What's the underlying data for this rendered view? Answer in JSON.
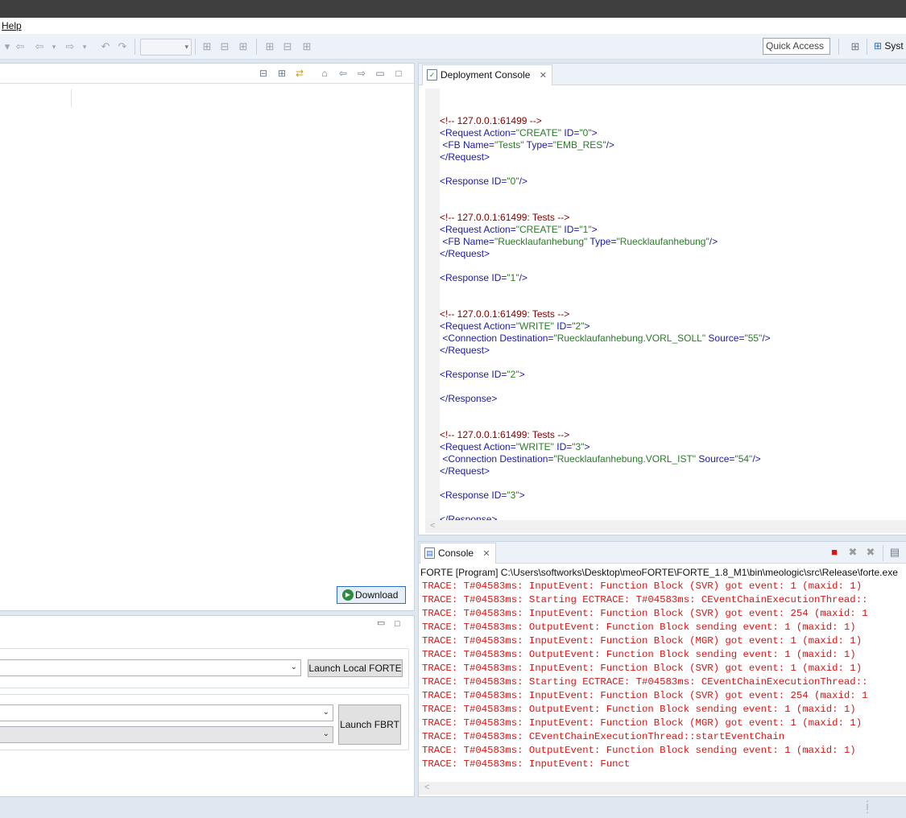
{
  "menubar": {
    "help": "Help"
  },
  "toolbar": {
    "quick_access": "Quick Access",
    "perspective": "Syst",
    "icons": [
      "back-icon",
      "forward-icon",
      "undo-icon",
      "redo-icon",
      "layout-icon"
    ]
  },
  "left_panel": {
    "download_button": "Download",
    "launch_local_forte": "Launch Local FORTE",
    "launch_fbrt": "Launch FBRT"
  },
  "deployment_console": {
    "tab_label": "Deployment Console",
    "lines": [
      {
        "parts": [
          {
            "c": "cm",
            "t": "<!-- 127.0.0.1:61499 -->"
          }
        ]
      },
      {
        "parts": [
          {
            "c": "tg",
            "t": "<Request Action="
          },
          {
            "c": "val",
            "t": "\"CREATE\""
          },
          {
            "c": "tg",
            "t": " ID="
          },
          {
            "c": "val",
            "t": "\"0\""
          },
          {
            "c": "tg",
            "t": ">"
          }
        ]
      },
      {
        "parts": [
          {
            "c": "tg",
            "t": " <FB Name="
          },
          {
            "c": "val",
            "t": "\"Tests\""
          },
          {
            "c": "tg",
            "t": " Type="
          },
          {
            "c": "val",
            "t": "\"EMB_RES\""
          },
          {
            "c": "tg",
            "t": "/>"
          }
        ]
      },
      {
        "parts": [
          {
            "c": "tg",
            "t": "</Request>"
          }
        ]
      },
      {
        "parts": []
      },
      {
        "parts": [
          {
            "c": "tg",
            "t": "<Response ID="
          },
          {
            "c": "val",
            "t": "\"0\""
          },
          {
            "c": "tg",
            "t": "/>"
          }
        ]
      },
      {
        "parts": []
      },
      {
        "parts": []
      },
      {
        "parts": [
          {
            "c": "cm",
            "t": "<!-- 127.0.0.1:61499: Tests -->"
          }
        ]
      },
      {
        "parts": [
          {
            "c": "tg",
            "t": "<Request Action="
          },
          {
            "c": "val",
            "t": "\"CREATE\""
          },
          {
            "c": "tg",
            "t": " ID="
          },
          {
            "c": "val",
            "t": "\"1\""
          },
          {
            "c": "tg",
            "t": ">"
          }
        ]
      },
      {
        "parts": [
          {
            "c": "tg",
            "t": " <FB Name="
          },
          {
            "c": "val",
            "t": "\"Ruecklaufanhebung\""
          },
          {
            "c": "tg",
            "t": " Type="
          },
          {
            "c": "val",
            "t": "\"Ruecklaufanhebung\""
          },
          {
            "c": "tg",
            "t": "/>"
          }
        ]
      },
      {
        "parts": [
          {
            "c": "tg",
            "t": "</Request>"
          }
        ]
      },
      {
        "parts": []
      },
      {
        "parts": [
          {
            "c": "tg",
            "t": "<Response ID="
          },
          {
            "c": "val",
            "t": "\"1\""
          },
          {
            "c": "tg",
            "t": "/>"
          }
        ]
      },
      {
        "parts": []
      },
      {
        "parts": []
      },
      {
        "parts": [
          {
            "c": "cm",
            "t": "<!-- 127.0.0.1:61499: Tests -->"
          }
        ]
      },
      {
        "parts": [
          {
            "c": "tg",
            "t": "<Request Action="
          },
          {
            "c": "val",
            "t": "\"WRITE\""
          },
          {
            "c": "tg",
            "t": " ID="
          },
          {
            "c": "val",
            "t": "\"2\""
          },
          {
            "c": "tg",
            "t": ">"
          }
        ]
      },
      {
        "parts": [
          {
            "c": "tg",
            "t": " <Connection Destination="
          },
          {
            "c": "val",
            "t": "\"Ruecklaufanhebung.VORL_SOLL\""
          },
          {
            "c": "tg",
            "t": " Source="
          },
          {
            "c": "val",
            "t": "\"55\""
          },
          {
            "c": "tg",
            "t": "/>"
          }
        ]
      },
      {
        "parts": [
          {
            "c": "tg",
            "t": "</Request>"
          }
        ]
      },
      {
        "parts": []
      },
      {
        "parts": [
          {
            "c": "tg",
            "t": "<Response ID="
          },
          {
            "c": "val",
            "t": "\"2\""
          },
          {
            "c": "tg",
            "t": ">"
          }
        ]
      },
      {
        "parts": []
      },
      {
        "parts": [
          {
            "c": "tg",
            "t": "</Response>"
          }
        ]
      },
      {
        "parts": []
      },
      {
        "parts": []
      },
      {
        "parts": [
          {
            "c": "cm",
            "t": "<!-- 127.0.0.1:61499: Tests -->"
          }
        ]
      },
      {
        "parts": [
          {
            "c": "tg",
            "t": "<Request Action="
          },
          {
            "c": "val",
            "t": "\"WRITE\""
          },
          {
            "c": "tg",
            "t": " ID="
          },
          {
            "c": "val",
            "t": "\"3\""
          },
          {
            "c": "tg",
            "t": ">"
          }
        ]
      },
      {
        "parts": [
          {
            "c": "tg",
            "t": " <Connection Destination="
          },
          {
            "c": "val",
            "t": "\"Ruecklaufanhebung.VORL_IST\""
          },
          {
            "c": "tg",
            "t": " Source="
          },
          {
            "c": "val",
            "t": "\"54\""
          },
          {
            "c": "tg",
            "t": "/>"
          }
        ]
      },
      {
        "parts": [
          {
            "c": "tg",
            "t": "</Request>"
          }
        ]
      },
      {
        "parts": []
      },
      {
        "parts": [
          {
            "c": "tg",
            "t": "<Response ID="
          },
          {
            "c": "val",
            "t": "\"3\""
          },
          {
            "c": "tg",
            "t": ">"
          }
        ]
      },
      {
        "parts": []
      },
      {
        "parts": [
          {
            "c": "tg",
            "t": "</Response>"
          }
        ]
      }
    ]
  },
  "console": {
    "tab_label": "Console",
    "process_label": "FORTE [Program] C:\\Users\\softworks\\Desktop\\meoFORTE\\FORTE_1.8_M1\\bin\\meologic\\src\\Release\\forte.exe",
    "trace_lines": [
      "TRACE: T#04583ms: InputEvent: Function Block (SVR) got event: 1 (maxid: 1)",
      "TRACE: T#04583ms: Starting ECTRACE: T#04583ms: CEventChainExecutionThread::",
      "TRACE: T#04583ms: InputEvent: Function Block (SVR) got event: 254 (maxid: 1",
      "TRACE: T#04583ms: OutputEvent: Function Block sending event: 1 (maxid: 1)",
      "TRACE: T#04583ms: InputEvent: Function Block (MGR) got event: 1 (maxid: 1)",
      "TRACE: T#04583ms: OutputEvent: Function Block sending event: 1 (maxid: 1)",
      "TRACE: T#04583ms: InputEvent: Function Block (SVR) got event: 1 (maxid: 1)",
      "TRACE: T#04583ms: Starting ECTRACE: T#04583ms: CEventChainExecutionThread::",
      "TRACE: T#04583ms: InputEvent: Function Block (SVR) got event: 254 (maxid: 1",
      "TRACE: T#04583ms: OutputEvent: Function Block sending event: 1 (maxid: 1)",
      "TRACE: T#04583ms: InputEvent: Function Block (MGR) got event: 1 (maxid: 1)",
      "TRACE: T#04583ms: CEventChainExecutionThread::startEventChain",
      "TRACE: T#04583ms: OutputEvent: Function Block sending event: 1 (maxid: 1)",
      "TRACE: T#04583ms: InputEvent: Funct"
    ]
  },
  "colors": {
    "trace_red": "#d81616",
    "xml_tag": "#1a1aa6",
    "xml_value": "#2a7a2a",
    "xml_comment": "#7f0000",
    "accent": "#2a6dc9"
  }
}
